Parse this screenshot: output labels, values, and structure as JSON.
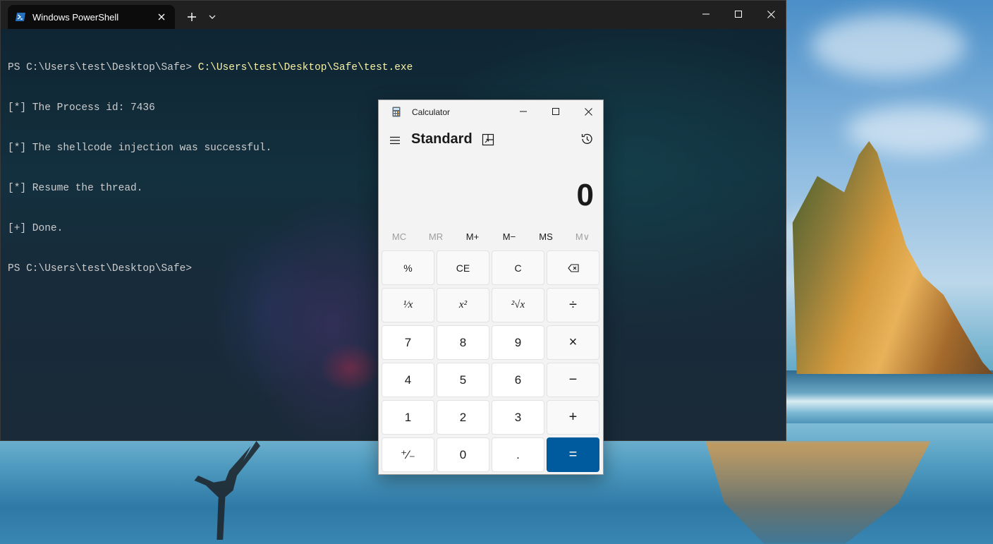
{
  "terminal": {
    "tab_title": "Windows PowerShell",
    "lines": [
      {
        "prompt": "PS C:\\Users\\test\\Desktop\\Safe> ",
        "command": "C:\\Users\\test\\Desktop\\Safe\\test.exe"
      },
      {
        "prompt": "[*] The Process id: 7436",
        "command": ""
      },
      {
        "prompt": "[*] The shellcode injection was successful.",
        "command": ""
      },
      {
        "prompt": "[*] Resume the thread.",
        "command": ""
      },
      {
        "prompt": "[+] Done.",
        "command": ""
      },
      {
        "prompt": "PS C:\\Users\\test\\Desktop\\Safe>",
        "command": ""
      }
    ],
    "colors": {
      "background": "#0c0c0c",
      "text": "#cccccc",
      "command": "#f9f1a5",
      "titlebar": "#202020"
    }
  },
  "calculator": {
    "title": "Calculator",
    "mode": "Standard",
    "display": "0",
    "memory": [
      {
        "label": "MC",
        "enabled": false
      },
      {
        "label": "MR",
        "enabled": false
      },
      {
        "label": "M+",
        "enabled": true
      },
      {
        "label": "M−",
        "enabled": true
      },
      {
        "label": "MS",
        "enabled": true
      },
      {
        "label": "M∨",
        "enabled": false
      }
    ],
    "keys": [
      {
        "label": "%",
        "name": "percent-key",
        "style": "op-small"
      },
      {
        "label": "CE",
        "name": "clear-entry-key",
        "style": "op-small"
      },
      {
        "label": "C",
        "name": "clear-key",
        "style": "op-small"
      },
      {
        "label": "",
        "name": "backspace-key",
        "style": "icon"
      },
      {
        "label": "¹⁄x",
        "name": "reciprocal-key",
        "style": "math"
      },
      {
        "label": "x²",
        "name": "square-key",
        "style": "math"
      },
      {
        "label": "²√x",
        "name": "square-root-key",
        "style": "math"
      },
      {
        "label": "÷",
        "name": "divide-key",
        "style": "op"
      },
      {
        "label": "7",
        "name": "digit-7-key",
        "style": "num"
      },
      {
        "label": "8",
        "name": "digit-8-key",
        "style": "num"
      },
      {
        "label": "9",
        "name": "digit-9-key",
        "style": "num"
      },
      {
        "label": "×",
        "name": "multiply-key",
        "style": "op"
      },
      {
        "label": "4",
        "name": "digit-4-key",
        "style": "num"
      },
      {
        "label": "5",
        "name": "digit-5-key",
        "style": "num"
      },
      {
        "label": "6",
        "name": "digit-6-key",
        "style": "num"
      },
      {
        "label": "−",
        "name": "subtract-key",
        "style": "op"
      },
      {
        "label": "1",
        "name": "digit-1-key",
        "style": "num"
      },
      {
        "label": "2",
        "name": "digit-2-key",
        "style": "num"
      },
      {
        "label": "3",
        "name": "digit-3-key",
        "style": "num"
      },
      {
        "label": "+",
        "name": "add-key",
        "style": "op"
      },
      {
        "label": "⁺⁄₋",
        "name": "negate-key",
        "style": "num"
      },
      {
        "label": "0",
        "name": "digit-0-key",
        "style": "num"
      },
      {
        "label": ".",
        "name": "decimal-key",
        "style": "num"
      },
      {
        "label": "=",
        "name": "equals-key",
        "style": "equals"
      }
    ],
    "colors": {
      "background": "#f3f3f3",
      "key": "#f9f9f9",
      "number_key": "#ffffff",
      "accent": "#005a9e"
    }
  }
}
